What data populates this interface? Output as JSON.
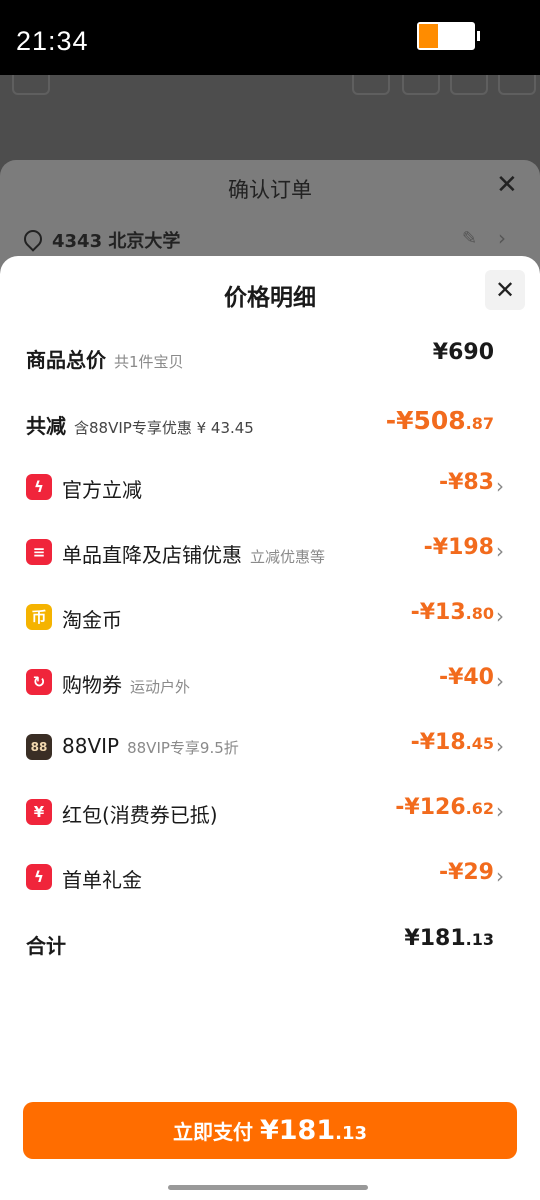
{
  "status_bar": {
    "time": "21:34",
    "battery_level": 0.35
  },
  "background": {
    "order_title": "确认订单",
    "address": "4343 北京大学"
  },
  "sheet": {
    "title": "价格明细",
    "total": {
      "label": "商品总价",
      "sub": "共1件宝贝",
      "amount": "¥690"
    },
    "reduction": {
      "label": "共减",
      "sub": "含88VIP专享优惠 ¥ 43.45",
      "amount_int": "-¥508",
      "amount_dec": ".87"
    },
    "items": [
      {
        "label": "官方立减",
        "sub": "",
        "amount_int": "-¥83",
        "amount_dec": "",
        "icon": "lightning-icon",
        "color": "#f0253b"
      },
      {
        "label": "单品直降及店铺优惠",
        "sub": "立减优惠等",
        "amount_int": "-¥198",
        "amount_dec": "",
        "icon": "shop-icon",
        "color": "#f0253b"
      },
      {
        "label": "淘金币",
        "sub": "",
        "amount_int": "-¥13",
        "amount_dec": ".80",
        "icon": "coin-icon",
        "color": "#f5b300"
      },
      {
        "label": "购物券",
        "sub": "运动户外",
        "amount_int": "-¥40",
        "amount_dec": "",
        "icon": "coupon-icon",
        "color": "#f0253b"
      },
      {
        "label": "88VIP",
        "sub": "88VIP专享9.5折",
        "amount_int": "-¥18",
        "amount_dec": ".45",
        "icon": "vip-icon",
        "color": "#3a2e25"
      },
      {
        "label": "红包(消费券已抵)",
        "sub": "",
        "amount_int": "-¥126",
        "amount_dec": ".62",
        "icon": "red-packet-icon",
        "color": "#f0253b"
      },
      {
        "label": "首单礼金",
        "sub": "",
        "amount_int": "-¥29",
        "amount_dec": "",
        "icon": "gift-icon",
        "color": "#f0253b"
      }
    ],
    "sum": {
      "label": "合计",
      "amount_int": "¥181",
      "amount_dec": ".13"
    }
  },
  "pay_button": {
    "label": "立即支付",
    "amount_int": "¥181",
    "amount_dec": ".13"
  },
  "colors": {
    "accent": "#ff6d00",
    "discount": "#f26b1d"
  }
}
